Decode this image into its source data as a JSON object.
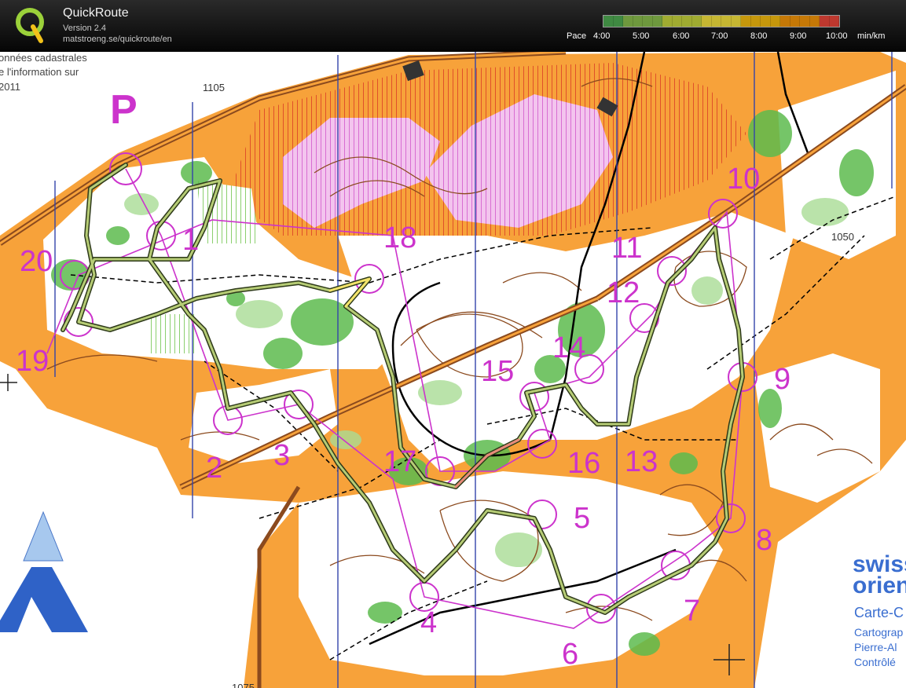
{
  "app": {
    "title": "QuickRoute",
    "version": "Version 2.4",
    "url": "matstroeng.se/quickroute/en",
    "logo_icon": "quickroute-q-logo-icon"
  },
  "pace_legend": {
    "label": "Pace",
    "ticks": [
      "4:00",
      "5:00",
      "6:00",
      "7:00",
      "8:00",
      "9:00",
      "10:00"
    ],
    "unit": "min/km",
    "colors": [
      "#4caf50",
      "#8bc34a",
      "#cddc39",
      "#ffeb3b",
      "#ffc107",
      "#ff9800",
      "#f44336"
    ]
  },
  "map": {
    "corner_text": [
      "onnées cadastrales",
      "e l'information sur",
      "2011"
    ],
    "parking_symbol": "P",
    "height_labels": [
      "1105",
      "1050",
      "1075"
    ],
    "controls": [
      "1",
      "2",
      "3",
      "4",
      "5",
      "6",
      "7",
      "8",
      "9",
      "10",
      "11",
      "12",
      "13",
      "14",
      "15",
      "16",
      "17",
      "18",
      "19",
      "20"
    ],
    "logo_text": [
      "swiss",
      "orien"
    ],
    "info_text": [
      "Carte-C",
      "Cartograp",
      "Pierre-Al",
      "Contrôlé"
    ],
    "colors": {
      "open_land": "#f7a23a",
      "forest": "#ffffff",
      "green": "#5dbb4e",
      "purple": "#cc33cc",
      "contour": "#8b4a1e",
      "grid": "#3344aa",
      "route": "#7fa35a"
    }
  }
}
